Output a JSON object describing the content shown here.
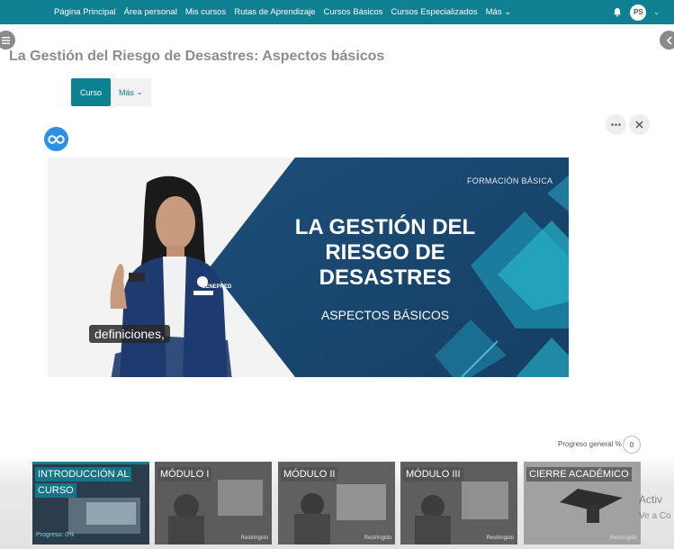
{
  "nav": {
    "links": [
      "Página Principal",
      "Área personal",
      "Mis cursos",
      "Rutas de Aprendizaje",
      "Cursos Básicos",
      "Cursos Especializados",
      "Más"
    ],
    "avatar_initials": "PS"
  },
  "page": {
    "title": "La Gestión del Riesgo de Desastres: Aspectos básicos"
  },
  "tabs": {
    "curso": "Curso",
    "mas": "Más"
  },
  "video": {
    "kicker": "FORMACIÓN BÁSICA",
    "title_lines": [
      "LA GESTIÓN DEL",
      "RIESGO DE",
      "DESASTRES"
    ],
    "subtitle": "ASPECTOS BÁSICOS",
    "caption": "definiciones,",
    "vest_text": "CENEPRED"
  },
  "progress": {
    "label": "Progreso general %",
    "value": "0"
  },
  "modules": [
    {
      "line1": "INTRODUCCIÓN AL",
      "line2": "CURSO",
      "status": "Progreso: 0%"
    },
    {
      "line1": "MÓDULO I",
      "status": "Restringido"
    },
    {
      "line1": "MÓDULO II",
      "status": "Restringido"
    },
    {
      "line1": "MÓDULO III",
      "status": "Restringido"
    },
    {
      "line1": "CIERRE ACADÉMICO",
      "status": "Restringido"
    }
  ],
  "watermark": {
    "line1": "Activ",
    "line2": "Ve a Co"
  },
  "colors": {
    "brand": "#0f7f92",
    "banner_dark": "#1f4f78"
  }
}
